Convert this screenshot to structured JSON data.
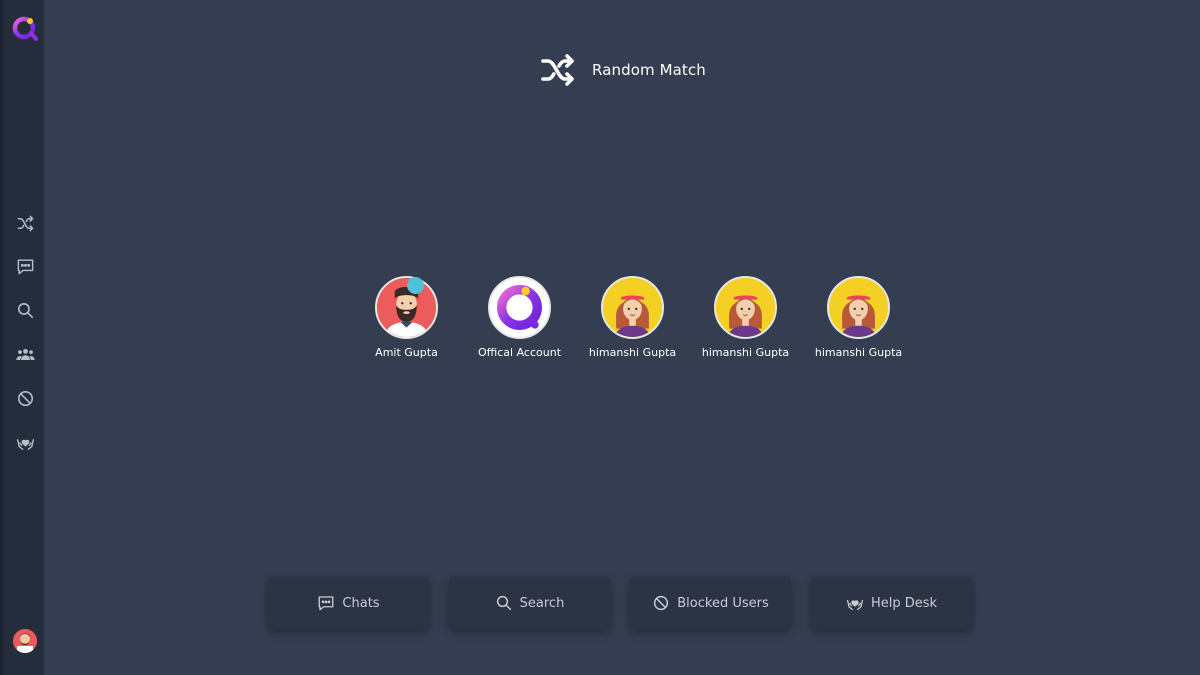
{
  "sidebar": {
    "logo": "app-logo",
    "items": [
      {
        "icon": "shuffle-icon",
        "label": "Random Match"
      },
      {
        "icon": "chat-icon",
        "label": "Chats"
      },
      {
        "icon": "search-icon",
        "label": "Search"
      },
      {
        "icon": "users-icon",
        "label": "Groups"
      },
      {
        "icon": "block-icon",
        "label": "Blocked Users"
      },
      {
        "icon": "helpdesk-icon",
        "label": "Help Desk"
      }
    ]
  },
  "header": {
    "title": "Random Match",
    "icon": "shuffle-icon"
  },
  "contacts": [
    {
      "name": "Amit Gupta",
      "avatar": "bearded-man-avatar",
      "online": true
    },
    {
      "name": "Offical Account",
      "avatar": "app-logo-avatar",
      "online": false
    },
    {
      "name": "himanshi Gupta",
      "avatar": "girl-avatar",
      "online": false
    },
    {
      "name": "himanshi Gupta",
      "avatar": "girl-avatar",
      "online": false
    },
    {
      "name": "himanshi Gupta",
      "avatar": "girl-avatar",
      "online": false
    }
  ],
  "bottom_buttons": [
    {
      "label": "Chats",
      "icon": "chat-icon"
    },
    {
      "label": "Search",
      "icon": "search-icon"
    },
    {
      "label": "Blocked Users",
      "icon": "block-icon"
    },
    {
      "label": "Help Desk",
      "icon": "helpdesk-icon"
    }
  ],
  "colors": {
    "background": "#353e51",
    "sidebar": "#252d3d",
    "button": "#2b3344",
    "online": "#4fc1d8",
    "accent_purple": "#9b3de8",
    "accent_yellow": "#f5d024"
  }
}
